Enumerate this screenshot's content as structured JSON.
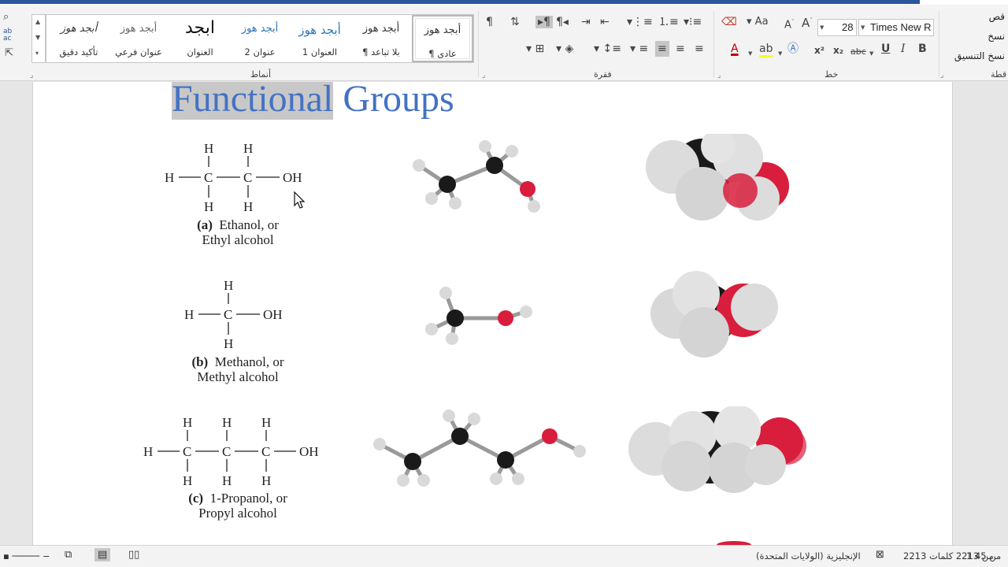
{
  "ribbon": {
    "styles_group_label": "أنماط",
    "paragraph_group_label": "فقرة",
    "font_group_label": "خط",
    "clipboard_group_label": "قطة",
    "styles": [
      {
        "preview": "أبجد هوز",
        "name": "¶ عادي",
        "active": true
      },
      {
        "preview": "أبجد هوز",
        "name": "¶ بلا تباعد"
      },
      {
        "preview": "أبجد هوز",
        "name": "العنوان 1"
      },
      {
        "preview": "أبجد هوز",
        "name": "عنوان 2"
      },
      {
        "preview": "ابجد",
        "name": "العنوان"
      },
      {
        "preview": "أبجد هوز",
        "name": "عنوان فرعي"
      },
      {
        "preview": "أبجد هوز",
        "name": "تأكيد دقيق"
      }
    ],
    "font_name": "Times New R",
    "font_size": "28",
    "clipboard": {
      "cut": "قص",
      "copy": "نسخ",
      "format_painter": "نسخ التنسيق"
    },
    "editing_side": {
      "find": "بحث",
      "replace": "ab ac"
    },
    "font_buttons": {
      "bold": "B",
      "italic": "I",
      "underline": "U",
      "strike": "abc",
      "subscript": "x₂",
      "superscript": "x²",
      "change_case": "Aa",
      "grow": "A",
      "shrink": "A"
    }
  },
  "document": {
    "title_selected": "Functional",
    "title_rest": " Groups",
    "molecules": [
      {
        "caption_tag": "(a)",
        "caption_line1": "Ethanol, or",
        "caption_line2": "Ethyl alcohol",
        "struct": {
          "h": "H",
          "c": "C",
          "oh": "OH"
        }
      },
      {
        "caption_tag": "(b)",
        "caption_line1": "Methanol, or",
        "caption_line2": "Methyl alcohol",
        "struct": {
          "h": "H",
          "c": "C",
          "oh": "OH"
        }
      },
      {
        "caption_tag": "(c)",
        "caption_line1": "1-Propanol, or",
        "caption_line2": "Propyl alcohol",
        "struct": {
          "h": "H",
          "c": "C",
          "oh": "OH"
        }
      }
    ],
    "colors": {
      "title": "#4472c4",
      "oxygen": "#d81e3c",
      "carbon": "#1a1a1a",
      "hydrogen": "#d9d9d9"
    }
  },
  "status": {
    "page_info": "1 من 45",
    "word_count": "2213 من 2213 كلمات",
    "language": "الإنجليزية (الولايات المتحدة)"
  }
}
